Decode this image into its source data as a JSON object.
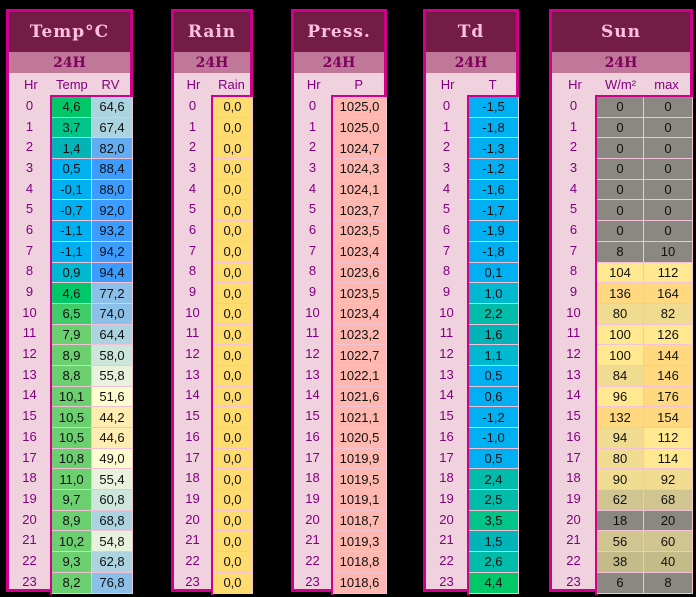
{
  "hours": [
    "0",
    "1",
    "2",
    "3",
    "4",
    "5",
    "6",
    "7",
    "8",
    "9",
    "10",
    "11",
    "12",
    "13",
    "14",
    "15",
    "16",
    "17",
    "18",
    "19",
    "20",
    "21",
    "22",
    "23"
  ],
  "colors": {
    "border": "#d0008c",
    "title_bg": "#721c46",
    "title_text": "#ffc0e0",
    "sub_bg": "#c07898",
    "rain": "#ffdc70",
    "pressure": "#ffb8b0"
  },
  "panels": [
    {
      "id": "temp",
      "title": "Temp°C",
      "sub": "24H",
      "hr_header": "Hr",
      "columns": [
        {
          "header": "Temp",
          "kind": "temp",
          "values": [
            "4,6",
            "3,7",
            "1,4",
            "0,5",
            "-0,1",
            "-0,7",
            "-1,1",
            "-1,1",
            "0,9",
            "4,6",
            "6,5",
            "7,9",
            "8,9",
            "8,8",
            "10,1",
            "10,5",
            "10,5",
            "10,8",
            "11,0",
            "9,7",
            "8,9",
            "10,2",
            "9,3",
            "8,2"
          ]
        },
        {
          "header": "RV",
          "kind": "rh",
          "values": [
            "64,6",
            "67,4",
            "82,0",
            "88,4",
            "88,0",
            "92,0",
            "93,2",
            "94,2",
            "94,4",
            "77,2",
            "74,0",
            "64,4",
            "58,0",
            "55,8",
            "51,6",
            "44,2",
            "44,6",
            "49,0",
            "55,4",
            "60,8",
            "68,8",
            "54,8",
            "62,8",
            "76,8"
          ]
        }
      ]
    },
    {
      "id": "rain",
      "title": "Rain",
      "sub": "24H",
      "hr_header": "Hr",
      "columns": [
        {
          "header": "Rain",
          "kind": "rain",
          "values": [
            "0,0",
            "0,0",
            "0,0",
            "0,0",
            "0,0",
            "0,0",
            "0,0",
            "0,0",
            "0,0",
            "0,0",
            "0,0",
            "0,0",
            "0,0",
            "0,0",
            "0,0",
            "0,0",
            "0,0",
            "0,0",
            "0,0",
            "0,0",
            "0,0",
            "0,0",
            "0,0",
            "0,0"
          ]
        }
      ]
    },
    {
      "id": "press",
      "title": "Press.",
      "sub": "24H",
      "hr_header": "Hr",
      "columns": [
        {
          "header": "P",
          "kind": "press",
          "values": [
            "1025,0",
            "1025,0",
            "1024,7",
            "1024,3",
            "1024,1",
            "1023,7",
            "1023,5",
            "1023,4",
            "1023,6",
            "1023,5",
            "1023,4",
            "1023,2",
            "1022,7",
            "1022,1",
            "1021,6",
            "1021,1",
            "1020,5",
            "1019,9",
            "1019,5",
            "1019,1",
            "1018,7",
            "1019,3",
            "1018,8",
            "1018,6"
          ]
        }
      ]
    },
    {
      "id": "td",
      "title": "Td",
      "sub": "24H",
      "hr_header": "Hr",
      "columns": [
        {
          "header": "T",
          "kind": "temp",
          "values": [
            "-1,5",
            "-1,8",
            "-1,3",
            "-1,2",
            "-1,6",
            "-1,7",
            "-1,9",
            "-1,8",
            "0,1",
            "1,0",
            "2,2",
            "1,6",
            "1,1",
            "0,5",
            "0,6",
            "-1,2",
            "-1,0",
            "0,5",
            "2,4",
            "2,5",
            "3,5",
            "1,5",
            "2,6",
            "4,4"
          ]
        }
      ]
    },
    {
      "id": "sun",
      "title": "Sun",
      "sub": "24H",
      "hr_header": "Hr",
      "columns": [
        {
          "header": "W/m²",
          "kind": "sun",
          "values": [
            "0",
            "0",
            "0",
            "0",
            "0",
            "0",
            "0",
            "8",
            "104",
            "136",
            "80",
            "100",
            "100",
            "84",
            "96",
            "132",
            "94",
            "80",
            "90",
            "62",
            "18",
            "56",
            "38",
            "6"
          ]
        },
        {
          "header": "max",
          "kind": "sun",
          "values": [
            "0",
            "0",
            "0",
            "0",
            "0",
            "0",
            "0",
            "10",
            "112",
            "164",
            "82",
            "126",
            "144",
            "146",
            "176",
            "154",
            "112",
            "114",
            "92",
            "68",
            "20",
            "60",
            "40",
            "8"
          ]
        }
      ]
    }
  ]
}
